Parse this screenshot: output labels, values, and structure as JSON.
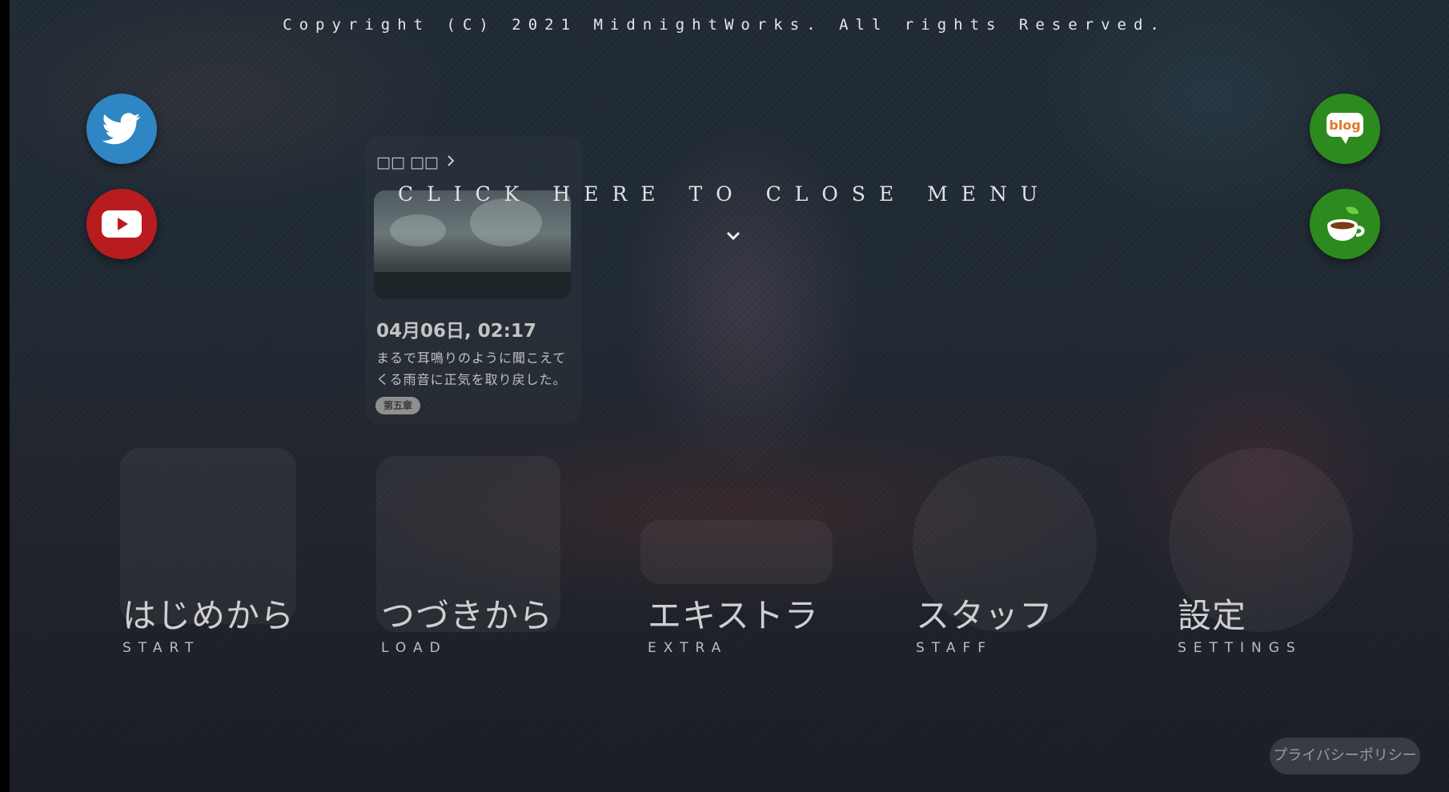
{
  "header": {
    "copyright": "Copyright (C) 2021 MidnightWorks. All rights Reserved."
  },
  "social": {
    "left": [
      {
        "icon": "twitter-bird-icon",
        "color": "#2f86c4"
      },
      {
        "icon": "youtube-play-icon",
        "color": "#b81c1f"
      }
    ],
    "right": [
      {
        "icon": "blog-speech-icon",
        "label": "blog",
        "color": "#2d8a1e"
      },
      {
        "icon": "teacup-icon",
        "color": "#2d8a1e"
      }
    ]
  },
  "news": {
    "header": "□□ □□",
    "date": "04月06日, 02:17",
    "text": "まるで耳鳴りのように聞こえてくる雨音に正気を取り戻した。",
    "tag": "第五章"
  },
  "overlay": {
    "close_text": "CLICK HERE TO CLOSE MENU"
  },
  "menu": {
    "items": [
      {
        "jp": "はじめから",
        "en": "START"
      },
      {
        "jp": "つづきから",
        "en": "LOAD"
      },
      {
        "jp": "エキストラ",
        "en": "EXTRA"
      },
      {
        "jp": "スタッフ",
        "en": "STAFF"
      },
      {
        "jp": "設定",
        "en": "SETTINGS"
      }
    ]
  },
  "footer": {
    "privacy": "プライバシーポリシー"
  },
  "colors": {
    "twitter": "#2f86c4",
    "youtube": "#b81c1f",
    "green": "#2d8a1e"
  }
}
